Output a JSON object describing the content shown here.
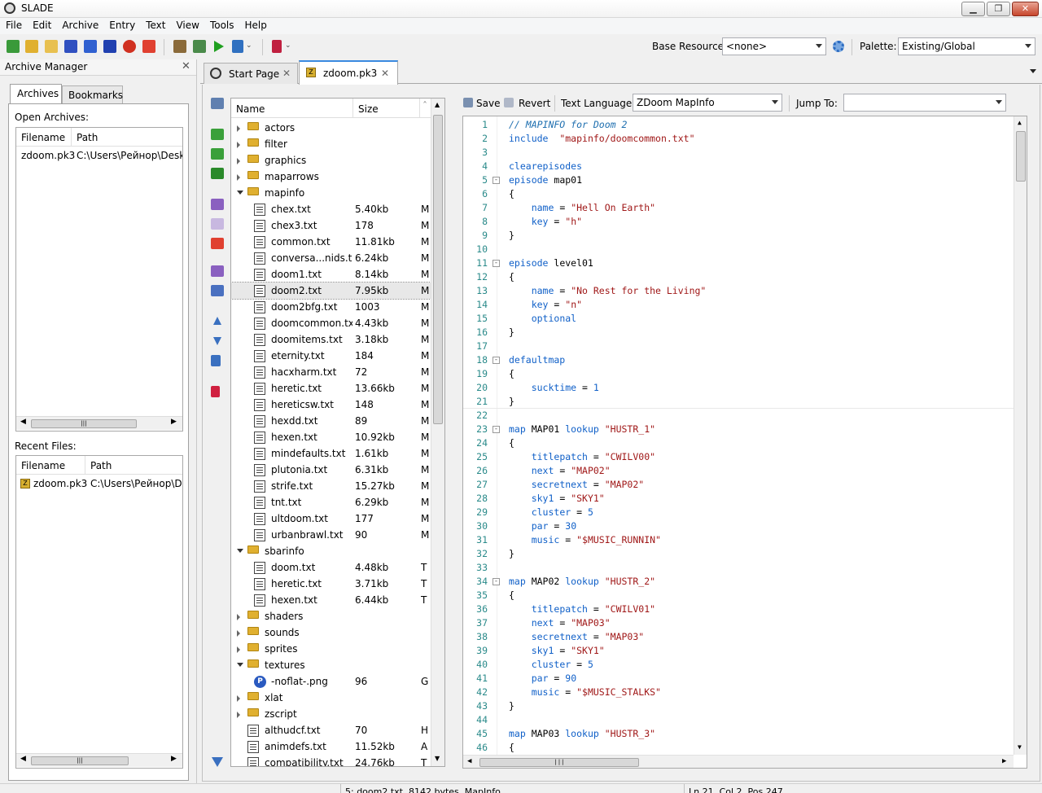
{
  "window": {
    "title": "SLADE"
  },
  "menu": [
    "File",
    "Edit",
    "Archive",
    "Entry",
    "Text",
    "View",
    "Tools",
    "Help"
  ],
  "toolbar": {
    "base_resource_label": "Base Resource:",
    "base_resource_value": "<none>",
    "palette_label": "Palette:",
    "palette_value": "Existing/Global"
  },
  "archive_manager": {
    "title": "Archive Manager",
    "tabs": [
      "Archives",
      "Bookmarks"
    ],
    "open_label": "Open Archives:",
    "recent_label": "Recent Files:",
    "columns": [
      "Filename",
      "Path"
    ],
    "open_rows": [
      {
        "filename": "zdoom.pk3",
        "path": "C:\\Users\\Рейнор\\Deskto"
      }
    ],
    "recent_rows": [
      {
        "filename": "zdoom.pk3",
        "path": "C:\\Users\\Рейнор\\Des"
      }
    ]
  },
  "tabs": [
    {
      "label": "Start Page"
    },
    {
      "label": "zdoom.pk3"
    }
  ],
  "entry_list": {
    "columns": [
      "Name",
      "Size"
    ],
    "rows": [
      {
        "name": "actors",
        "type": "folder",
        "state": "closed",
        "indent": 0
      },
      {
        "name": "filter",
        "type": "folder",
        "state": "closed",
        "indent": 0
      },
      {
        "name": "graphics",
        "type": "folder",
        "state": "closed",
        "indent": 0
      },
      {
        "name": "maparrows",
        "type": "folder",
        "state": "closed",
        "indent": 0
      },
      {
        "name": "mapinfo",
        "type": "folder",
        "state": "open",
        "indent": 0
      },
      {
        "name": "chex.txt",
        "type": "file",
        "size": "5.40kb",
        "t": "M",
        "indent": 1
      },
      {
        "name": "chex3.txt",
        "type": "file",
        "size": "178",
        "t": "M",
        "indent": 1
      },
      {
        "name": "common.txt",
        "type": "file",
        "size": "11.81kb",
        "t": "M",
        "indent": 1
      },
      {
        "name": "conversa...nids.txt",
        "type": "file",
        "size": "6.24kb",
        "t": "M",
        "indent": 1
      },
      {
        "name": "doom1.txt",
        "type": "file",
        "size": "8.14kb",
        "t": "M",
        "indent": 1
      },
      {
        "name": "doom2.txt",
        "type": "file",
        "size": "7.95kb",
        "t": "M",
        "indent": 1,
        "selected": true
      },
      {
        "name": "doom2bfg.txt",
        "type": "file",
        "size": "1003",
        "t": "M",
        "indent": 1
      },
      {
        "name": "doomcommon.txt",
        "type": "file",
        "size": "4.43kb",
        "t": "M",
        "indent": 1
      },
      {
        "name": "doomitems.txt",
        "type": "file",
        "size": "3.18kb",
        "t": "M",
        "indent": 1
      },
      {
        "name": "eternity.txt",
        "type": "file",
        "size": "184",
        "t": "M",
        "indent": 1
      },
      {
        "name": "hacxharm.txt",
        "type": "file",
        "size": "72",
        "t": "M",
        "indent": 1
      },
      {
        "name": "heretic.txt",
        "type": "file",
        "size": "13.66kb",
        "t": "M",
        "indent": 1
      },
      {
        "name": "hereticsw.txt",
        "type": "file",
        "size": "148",
        "t": "M",
        "indent": 1
      },
      {
        "name": "hexdd.txt",
        "type": "file",
        "size": "89",
        "t": "M",
        "indent": 1
      },
      {
        "name": "hexen.txt",
        "type": "file",
        "size": "10.92kb",
        "t": "M",
        "indent": 1
      },
      {
        "name": "mindefaults.txt",
        "type": "file",
        "size": "1.61kb",
        "t": "M",
        "indent": 1
      },
      {
        "name": "plutonia.txt",
        "type": "file",
        "size": "6.31kb",
        "t": "M",
        "indent": 1
      },
      {
        "name": "strife.txt",
        "type": "file",
        "size": "15.27kb",
        "t": "M",
        "indent": 1
      },
      {
        "name": "tnt.txt",
        "type": "file",
        "size": "6.29kb",
        "t": "M",
        "indent": 1
      },
      {
        "name": "ultdoom.txt",
        "type": "file",
        "size": "177",
        "t": "M",
        "indent": 1
      },
      {
        "name": "urbanbrawl.txt",
        "type": "file",
        "size": "90",
        "t": "M",
        "indent": 1
      },
      {
        "name": "sbarinfo",
        "type": "folder",
        "state": "open",
        "indent": 0
      },
      {
        "name": "doom.txt",
        "type": "file",
        "size": "4.48kb",
        "t": "T",
        "indent": 1
      },
      {
        "name": "heretic.txt",
        "type": "file",
        "size": "3.71kb",
        "t": "T",
        "indent": 1
      },
      {
        "name": "hexen.txt",
        "type": "file",
        "size": "6.44kb",
        "t": "T",
        "indent": 1
      },
      {
        "name": "shaders",
        "type": "folder",
        "state": "closed",
        "indent": 0
      },
      {
        "name": "sounds",
        "type": "folder",
        "state": "closed",
        "indent": 0
      },
      {
        "name": "sprites",
        "type": "folder",
        "state": "closed",
        "indent": 0
      },
      {
        "name": "textures",
        "type": "folder",
        "state": "open",
        "indent": 0
      },
      {
        "name": "-noflat-.png",
        "type": "png",
        "size": "96",
        "t": "G",
        "indent": 1
      },
      {
        "name": "xlat",
        "type": "folder",
        "state": "closed",
        "indent": 0
      },
      {
        "name": "zscript",
        "type": "folder",
        "state": "closed",
        "indent": 0
      },
      {
        "name": "althudcf.txt",
        "type": "file",
        "size": "70",
        "t": "H",
        "indent": 0
      },
      {
        "name": "animdefs.txt",
        "type": "file",
        "size": "11.52kb",
        "t": "A",
        "indent": 0
      },
      {
        "name": "compatibility.txt",
        "type": "file",
        "size": "24.76kb",
        "t": "T",
        "indent": 0
      }
    ]
  },
  "editor_toolbar": {
    "save": "Save",
    "revert": "Revert",
    "text_language_label": "Text Language:",
    "text_language_value": "ZDoom MapInfo",
    "jump_to_label": "Jump To:",
    "jump_to_value": ""
  },
  "code": [
    [
      [
        "cm",
        "// MAPINFO for Doom 2"
      ]
    ],
    [
      [
        "kw",
        "include"
      ],
      [
        "",
        "  "
      ],
      [
        "str",
        "\"mapinfo/doomcommon.txt\""
      ]
    ],
    [],
    [
      [
        "kw",
        "clearepisodes"
      ]
    ],
    [
      [
        "kw",
        "episode"
      ],
      [
        "",
        " map01"
      ]
    ],
    [
      [
        "",
        "{"
      ]
    ],
    [
      [
        "",
        "    "
      ],
      [
        "kw",
        "name"
      ],
      [
        "",
        " = "
      ],
      [
        "str",
        "\"Hell On Earth\""
      ]
    ],
    [
      [
        "",
        "    "
      ],
      [
        "kw",
        "key"
      ],
      [
        "",
        " = "
      ],
      [
        "str",
        "\"h\""
      ]
    ],
    [
      [
        "",
        "}"
      ]
    ],
    [],
    [
      [
        "kw",
        "episode"
      ],
      [
        "",
        " level01"
      ]
    ],
    [
      [
        "",
        "{"
      ]
    ],
    [
      [
        "",
        "    "
      ],
      [
        "kw",
        "name"
      ],
      [
        "",
        " = "
      ],
      [
        "str",
        "\"No Rest for the Living\""
      ]
    ],
    [
      [
        "",
        "    "
      ],
      [
        "kw",
        "key"
      ],
      [
        "",
        " = "
      ],
      [
        "str",
        "\"n\""
      ]
    ],
    [
      [
        "",
        "    "
      ],
      [
        "kw",
        "optional"
      ]
    ],
    [
      [
        "",
        "}"
      ]
    ],
    [],
    [
      [
        "kw",
        "defaultmap"
      ]
    ],
    [
      [
        "",
        "{"
      ]
    ],
    [
      [
        "",
        "    "
      ],
      [
        "kw",
        "sucktime"
      ],
      [
        "",
        " = "
      ],
      [
        "kw",
        "1"
      ]
    ],
    [
      [
        "",
        "}"
      ]
    ],
    [],
    [
      [
        "kw",
        "map"
      ],
      [
        "",
        " MAP01 "
      ],
      [
        "kw",
        "lookup"
      ],
      [
        "",
        " "
      ],
      [
        "str",
        "\"HUSTR_1\""
      ]
    ],
    [
      [
        "",
        "{"
      ]
    ],
    [
      [
        "",
        "    "
      ],
      [
        "kw",
        "titlepatch"
      ],
      [
        "",
        " = "
      ],
      [
        "str",
        "\"CWILV00\""
      ]
    ],
    [
      [
        "",
        "    "
      ],
      [
        "kw",
        "next"
      ],
      [
        "",
        " = "
      ],
      [
        "str",
        "\"MAP02\""
      ]
    ],
    [
      [
        "",
        "    "
      ],
      [
        "kw",
        "secretnext"
      ],
      [
        "",
        " = "
      ],
      [
        "str",
        "\"MAP02\""
      ]
    ],
    [
      [
        "",
        "    "
      ],
      [
        "kw",
        "sky1"
      ],
      [
        "",
        " = "
      ],
      [
        "str",
        "\"SKY1\""
      ]
    ],
    [
      [
        "",
        "    "
      ],
      [
        "kw",
        "cluster"
      ],
      [
        "",
        " = "
      ],
      [
        "kw",
        "5"
      ]
    ],
    [
      [
        "",
        "    "
      ],
      [
        "kw",
        "par"
      ],
      [
        "",
        " = "
      ],
      [
        "kw",
        "30"
      ]
    ],
    [
      [
        "",
        "    "
      ],
      [
        "kw",
        "music"
      ],
      [
        "",
        " = "
      ],
      [
        "str",
        "\"$MUSIC_RUNNIN\""
      ]
    ],
    [
      [
        "",
        "}"
      ]
    ],
    [],
    [
      [
        "kw",
        "map"
      ],
      [
        "",
        " MAP02 "
      ],
      [
        "kw",
        "lookup"
      ],
      [
        "",
        " "
      ],
      [
        "str",
        "\"HUSTR_2\""
      ]
    ],
    [
      [
        "",
        "{"
      ]
    ],
    [
      [
        "",
        "    "
      ],
      [
        "kw",
        "titlepatch"
      ],
      [
        "",
        " = "
      ],
      [
        "str",
        "\"CWILV01\""
      ]
    ],
    [
      [
        "",
        "    "
      ],
      [
        "kw",
        "next"
      ],
      [
        "",
        " = "
      ],
      [
        "str",
        "\"MAP03\""
      ]
    ],
    [
      [
        "",
        "    "
      ],
      [
        "kw",
        "secretnext"
      ],
      [
        "",
        " = "
      ],
      [
        "str",
        "\"MAP03\""
      ]
    ],
    [
      [
        "",
        "    "
      ],
      [
        "kw",
        "sky1"
      ],
      [
        "",
        " = "
      ],
      [
        "str",
        "\"SKY1\""
      ]
    ],
    [
      [
        "",
        "    "
      ],
      [
        "kw",
        "cluster"
      ],
      [
        "",
        " = "
      ],
      [
        "kw",
        "5"
      ]
    ],
    [
      [
        "",
        "    "
      ],
      [
        "kw",
        "par"
      ],
      [
        "",
        " = "
      ],
      [
        "kw",
        "90"
      ]
    ],
    [
      [
        "",
        "    "
      ],
      [
        "kw",
        "music"
      ],
      [
        "",
        " = "
      ],
      [
        "str",
        "\"$MUSIC_STALKS\""
      ]
    ],
    [
      [
        "",
        "}"
      ]
    ],
    [],
    [
      [
        "kw",
        "map"
      ],
      [
        "",
        " MAP03 "
      ],
      [
        "kw",
        "lookup"
      ],
      [
        "",
        " "
      ],
      [
        "str",
        "\"HUSTR_3\""
      ]
    ],
    [
      [
        "",
        "{"
      ]
    ]
  ],
  "fold_lines": [
    5,
    11,
    18,
    23,
    34
  ],
  "current_line": 21,
  "status": {
    "entry": "5: doom2.txt, 8142 bytes, MapInfo",
    "position": "Ln 21, Col 2, Pos 247"
  }
}
